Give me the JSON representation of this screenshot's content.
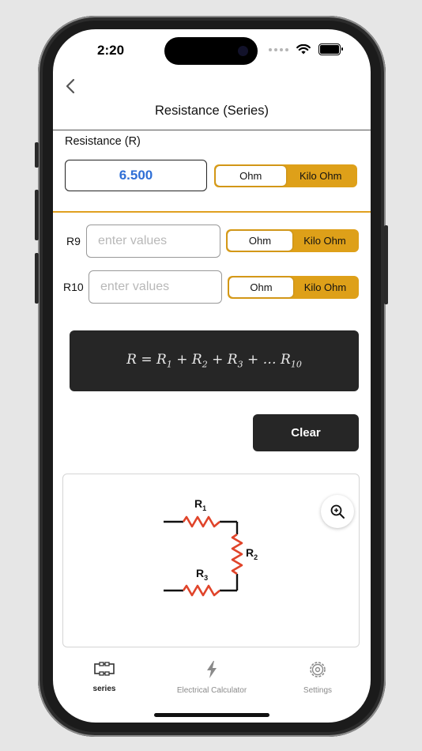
{
  "status_bar": {
    "time": "2:20"
  },
  "header": {
    "title": "Resistance (Series)"
  },
  "result": {
    "label": "Resistance (R)",
    "value": "6.500",
    "units": [
      "Ohm",
      "Kilo Ohm"
    ],
    "selected_unit": "Ohm"
  },
  "rows": [
    {
      "label": "R9",
      "placeholder": "enter values",
      "units": [
        "Ohm",
        "Kilo Ohm"
      ],
      "selected_unit": "Ohm"
    },
    {
      "label": "R10",
      "placeholder": "enter values",
      "units": [
        "Ohm",
        "Kilo Ohm"
      ],
      "selected_unit": "Ohm"
    }
  ],
  "formula": {
    "lhs": "R",
    "terms": [
      "R1",
      "R2",
      "R3",
      "… R10"
    ]
  },
  "actions": {
    "clear_label": "Clear"
  },
  "diagram": {
    "labels": {
      "r1": "R",
      "r1_sub": "1",
      "r2": "R",
      "r2_sub": "2",
      "r3": "R",
      "r3_sub": "3"
    },
    "resistor_color": "#e0442a"
  },
  "tabbar": {
    "items": [
      {
        "label": "series",
        "icon": "series-circuit-icon",
        "active": true
      },
      {
        "label": "Electrical Calculator",
        "icon": "lightning-icon",
        "active": false
      },
      {
        "label": "Settings",
        "icon": "gear-icon",
        "active": false
      }
    ]
  },
  "colors": {
    "accent_gold": "#dea019",
    "value_blue": "#2f6fd6",
    "dark_panel": "#262626"
  }
}
